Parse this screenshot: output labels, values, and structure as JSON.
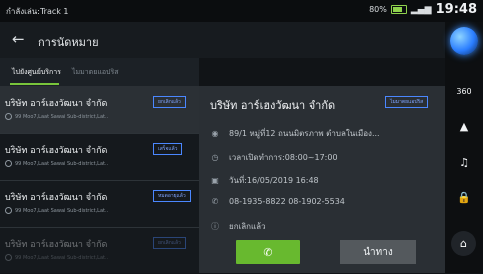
{
  "status_bar": {
    "track": "กำลังเล่น:Track 1",
    "battery": "80%",
    "time": "19:48"
  },
  "header": {
    "title": "การนัดหมาย"
  },
  "tabs": [
    {
      "label": "ไปยังศูนย์บริการ"
    },
    {
      "label": "ไมมาตยแอปริส"
    }
  ],
  "list": {
    "items": [
      {
        "name": "บริษัท อาร์เฮงวัฒนา จำกัด",
        "addr": "99 Moo7,Laat Sawai Sub-district,Lat..",
        "badge": "ยกเลิกแล้ว"
      },
      {
        "name": "บริษัท อาร์เฮงวัฒนา จำกัด",
        "addr": "99 Moo7,Laat Sawai Sub-district,Lat..",
        "badge": "เสร็จแล้ว"
      },
      {
        "name": "บริษัท อาร์เฮงวัฒนา จำกัด",
        "addr": "99 Moo7,Laat Sawai Sub-district,Lat..",
        "badge": "หมดอายุแล้ว"
      },
      {
        "name": "บริษัท อาร์เฮงวัฒนา จำกัด",
        "addr": "99 Moo7,Laat Sawai Sub-district,Lat..",
        "badge": "ยกเลิกแล้ว"
      }
    ]
  },
  "detail": {
    "title": "บริษัท อาร์เฮงวัฒนา จำกัด",
    "badge": "ไมมาตยแอปริส",
    "address": "89/1 หมู่ที่12 ถนนมิตรภาพ  ตำบลในเมือง...",
    "hours": "เวลาเปิดทำการ:08:00~17:00",
    "date": "วันที่:16/05/2019 16:48",
    "phone": "08-1935-8822   08-1902-5534",
    "status": "ยกเลิกแล้ว",
    "call_icon": "phone-icon",
    "nav_label": "นำทาง"
  },
  "rail": {
    "icon_360": "360"
  },
  "colors": {
    "accent": "#79c53b",
    "call_button": "#68b92f",
    "badge_blue": "#4b87ff"
  }
}
